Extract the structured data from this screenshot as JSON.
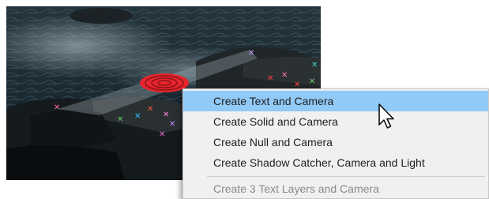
{
  "viewer": {
    "content": "Water and rock footage with camera tracker target and track points"
  },
  "context_menu": {
    "items": [
      {
        "label": "Create Text and Camera",
        "state": "highlighted"
      },
      {
        "label": "Create Solid and Camera",
        "state": "normal"
      },
      {
        "label": "Create Null and Camera",
        "state": "normal"
      },
      {
        "label": "Create Shadow Catcher, Camera and Light",
        "state": "normal"
      },
      {
        "label": "Create 3 Text Layers and Camera",
        "state": "disabled"
      }
    ]
  },
  "colors": {
    "highlight": "#91c9f7",
    "target_red": "#e8242c",
    "menu_background": "#f0f0f0",
    "disabled_text": "#8a8a8a"
  },
  "icons": {
    "cursor": "arrow-pointer-icon",
    "track_point": "track-point-icon"
  }
}
